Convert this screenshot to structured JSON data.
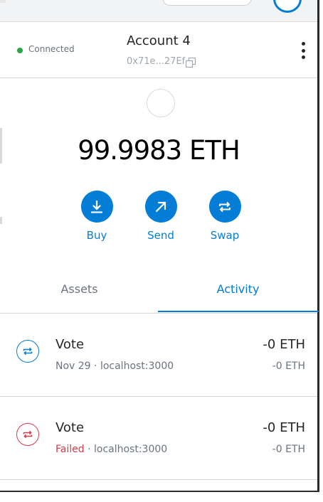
{
  "header": {
    "connection_status": "Connected",
    "account_name": "Account 4",
    "account_address": "0x71e...27Ef"
  },
  "balance": {
    "amount_text": "99.9983 ETH"
  },
  "actions": {
    "buy_label": "Buy",
    "send_label": "Send",
    "swap_label": "Swap"
  },
  "tabs": {
    "assets_label": "Assets",
    "activity_label": "Activity",
    "active": "activity"
  },
  "activity": [
    {
      "title": "Vote",
      "date": "Nov 29",
      "status": "",
      "origin": "localhost:3000",
      "amount_primary": "-0 ETH",
      "amount_secondary": "-0 ETH",
      "icon": "swap-arrows-icon"
    },
    {
      "title": "Vote",
      "date": "",
      "status": "Failed",
      "origin": "localhost:3000",
      "amount_primary": "-0 ETH",
      "amount_secondary": "-0 ETH",
      "icon": "swap-arrows-icon"
    }
  ],
  "colors": {
    "accent": "#037dd6",
    "connected": "#28a745",
    "failed": "#d73a49",
    "text_primary": "#24272a",
    "text_secondary": "#6a737d"
  },
  "sep": " · "
}
